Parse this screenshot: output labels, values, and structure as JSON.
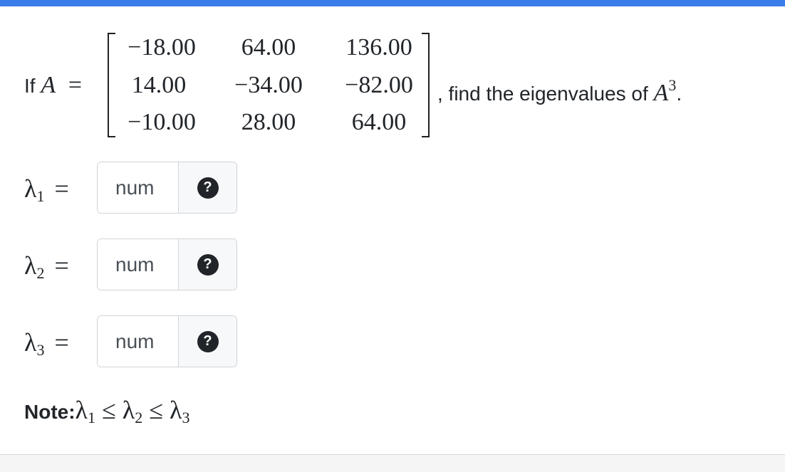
{
  "question": {
    "prefix": "If",
    "matrix_var": "A",
    "equals": "=",
    "matrix": [
      [
        "−18.00",
        "64.00",
        "136.00"
      ],
      [
        "14.00",
        "−34.00",
        "−82.00"
      ],
      [
        "−10.00",
        "28.00",
        "64.00"
      ]
    ],
    "suffix_text": ", find the eigenvalues of",
    "power_var": "A",
    "power_exp": "3",
    "period": "."
  },
  "answers": [
    {
      "symbol": "λ",
      "sub": "1",
      "eq": "=",
      "placeholder": "num",
      "help": "?"
    },
    {
      "symbol": "λ",
      "sub": "2",
      "eq": "=",
      "placeholder": "num",
      "help": "?"
    },
    {
      "symbol": "λ",
      "sub": "3",
      "eq": "=",
      "placeholder": "num",
      "help": "?"
    }
  ],
  "note": {
    "label": "Note:",
    "lambda": "λ",
    "leq": "≤",
    "subs": [
      "1",
      "2",
      "3"
    ]
  },
  "colors": {
    "top_bar": "#3b7de9",
    "help_icon_bg": "#212529",
    "input_border": "#d0d4d9"
  }
}
